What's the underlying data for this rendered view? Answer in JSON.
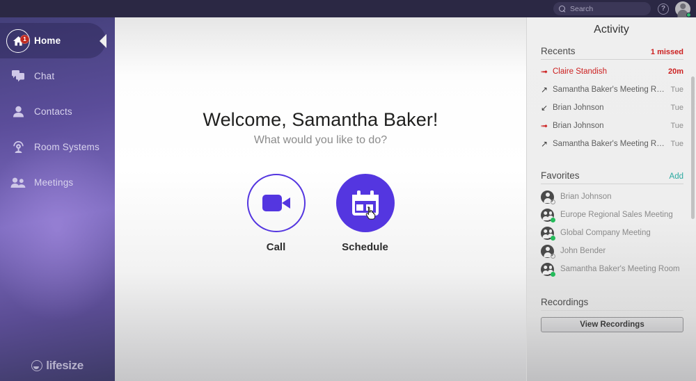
{
  "header": {
    "search": {
      "placeholder": "Search",
      "icon": "search-icon"
    },
    "help_label": "?",
    "avatar": {
      "presence": "online"
    }
  },
  "sidebar": {
    "items": [
      {
        "label": "Home",
        "icon": "home-icon",
        "active": true,
        "badge": "1"
      },
      {
        "label": "Chat",
        "icon": "chat-icon",
        "active": false,
        "badge": ""
      },
      {
        "label": "Contacts",
        "icon": "contacts-icon",
        "active": false,
        "badge": ""
      },
      {
        "label": "Room Systems",
        "icon": "room-systems-icon",
        "active": false,
        "badge": ""
      },
      {
        "label": "Meetings",
        "icon": "meetings-icon",
        "active": false,
        "badge": ""
      }
    ],
    "logo_text": "lifesize"
  },
  "main": {
    "welcome": "Welcome, Samantha Baker!",
    "subtitle": "What would you like to do?",
    "actions": [
      {
        "label": "Call",
        "icon": "video-camera-icon",
        "style": "outline"
      },
      {
        "label": "Schedule",
        "icon": "calendar-icon",
        "style": "filled"
      }
    ]
  },
  "activity": {
    "title": "Activity",
    "recents": {
      "title": "Recents",
      "missed_label": "1 missed",
      "items": [
        {
          "name": "Claire Standish",
          "time": "20m",
          "direction": "missed",
          "missed": true
        },
        {
          "name": "Samantha Baker's Meeting Room",
          "time": "Tue",
          "direction": "outgoing",
          "missed": false
        },
        {
          "name": "Brian Johnson",
          "time": "Tue",
          "direction": "incoming",
          "missed": false
        },
        {
          "name": "Brian Johnson",
          "time": "Tue",
          "direction": "missed",
          "missed": false
        },
        {
          "name": "Samantha Baker's Meeting Room",
          "time": "Tue",
          "direction": "outgoing",
          "missed": false
        }
      ]
    },
    "favorites": {
      "title": "Favorites",
      "add_label": "Add",
      "items": [
        {
          "name": "Brian Johnson",
          "type": "person",
          "presence": "offline"
        },
        {
          "name": "Europe Regional Sales Meeting",
          "type": "group",
          "presence": "online"
        },
        {
          "name": "Global Company Meeting",
          "type": "group",
          "presence": "online"
        },
        {
          "name": "John Bender",
          "type": "person",
          "presence": "offline"
        },
        {
          "name": "Samantha Baker's Meeting Room",
          "type": "group",
          "presence": "online"
        }
      ]
    },
    "recordings": {
      "title": "Recordings",
      "button_label": "View Recordings"
    }
  },
  "colors": {
    "topbar": "#2b2844",
    "accent_purple": "#5436e0",
    "missed_red": "#cc1f1f",
    "add_teal": "#2aa9a0",
    "online_green": "#25bb5b",
    "badge_red": "#c0271c"
  }
}
